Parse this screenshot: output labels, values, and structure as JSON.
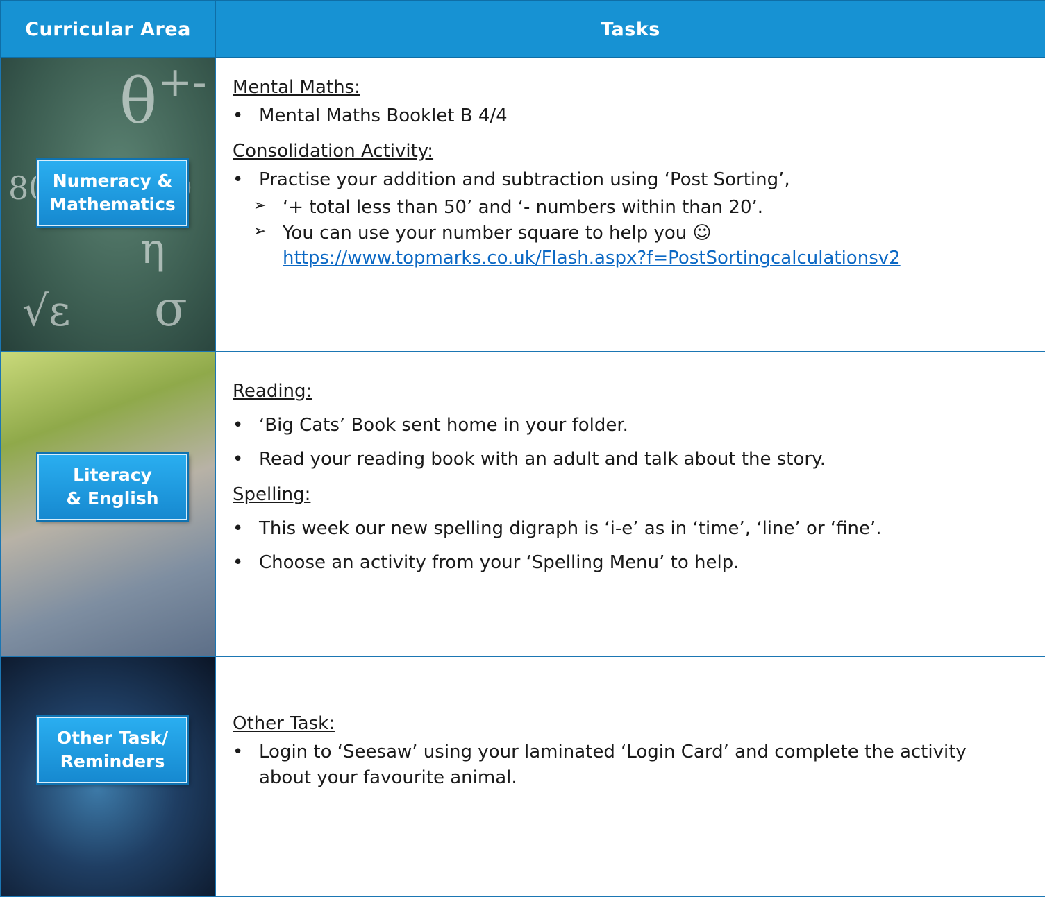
{
  "header": {
    "area": "Curricular Area",
    "tasks": "Tasks"
  },
  "rows": [
    {
      "label": [
        "Numeracy &",
        "Mathematics"
      ],
      "sections": [
        {
          "heading": "Mental Maths:",
          "items": [
            "Mental Maths Booklet B 4/4"
          ]
        },
        {
          "heading": "Consolidation Activity:",
          "items": [
            "Practise your addition and subtraction using ‘Post Sorting’,"
          ],
          "subitems": [
            "‘+ total less than 50’ and ‘- numbers within than 20’.",
            "You can use your number square to help you ☺"
          ],
          "link": "https://www.topmarks.co.uk/Flash.aspx?f=PostSortingcalculationsv2"
        }
      ]
    },
    {
      "label": [
        "Literacy",
        "& English"
      ],
      "sections": [
        {
          "heading": "Reading:",
          "items": [
            "‘Big Cats’ Book sent home in your folder.",
            "Read your reading book with an adult and talk about the story."
          ]
        },
        {
          "heading": "Spelling:",
          "items": [
            "This week our new spelling digraph is ‘i-e’ as in ‘time’, ‘line’ or ‘fine’.",
            "Choose an activity from your ‘Spelling Menu’ to help."
          ]
        }
      ]
    },
    {
      "label": [
        "Other Task/",
        "Reminders"
      ],
      "sections": [
        {
          "heading": "Other Task:",
          "items": [
            "Login to ‘Seesaw’ using your laminated ‘Login Card’ and complete the activity about your favourite animal."
          ]
        }
      ]
    }
  ],
  "colors": {
    "header_bg": "#1792d3",
    "label_bg": "#1f9ee2",
    "link": "#0b68c4"
  }
}
